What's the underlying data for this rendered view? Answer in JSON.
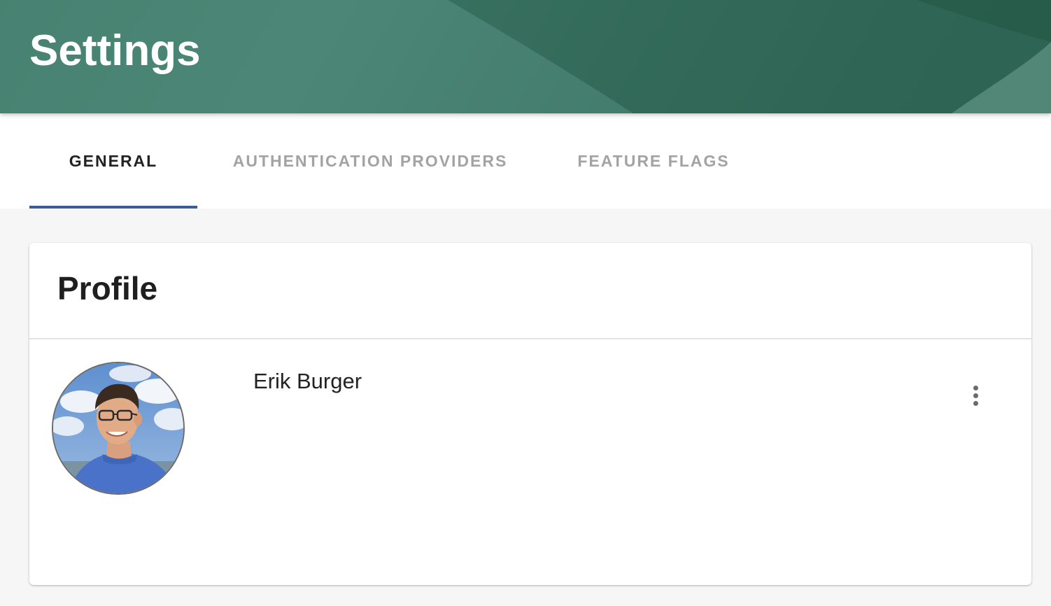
{
  "header": {
    "title": "Settings",
    "colors": {
      "base": "#3f7a67",
      "dark": "#2c6150",
      "light": "#568a7a"
    }
  },
  "tabs": [
    {
      "label": "GENERAL",
      "active": true
    },
    {
      "label": "AUTHENTICATION PROVIDERS",
      "active": false
    },
    {
      "label": "FEATURE FLAGS",
      "active": false
    }
  ],
  "tab_indicator_color": "#3b5c96",
  "profile": {
    "title": "Profile",
    "name": "Erik Burger",
    "avatar_icon": "user-photo-avatar",
    "more_icon": "more-vertical-icon"
  }
}
